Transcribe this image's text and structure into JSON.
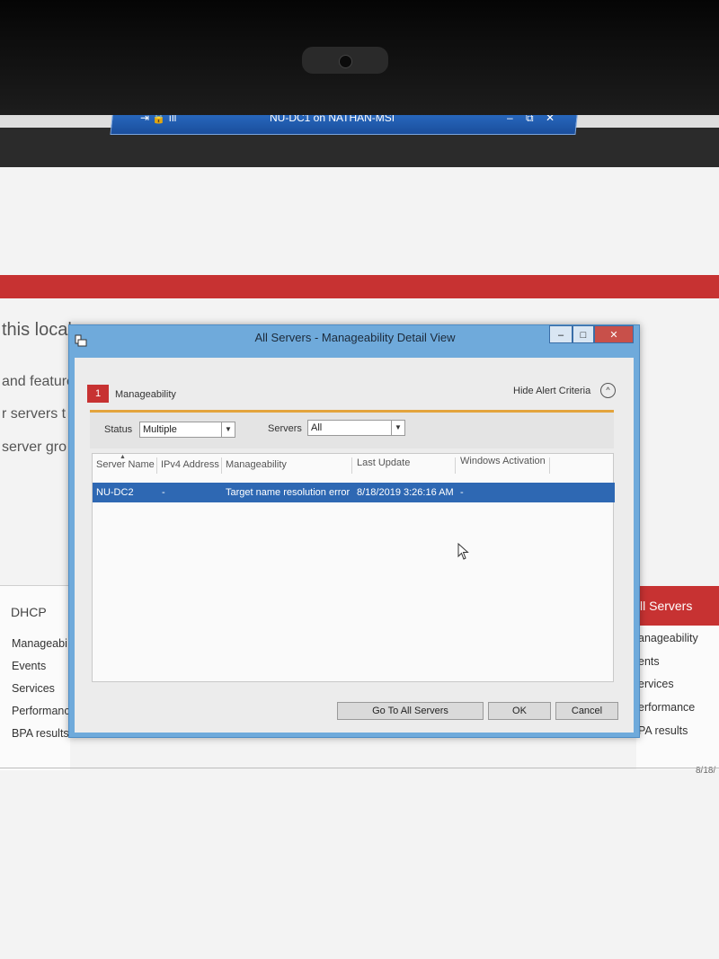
{
  "rdp_bar": {
    "title": "NU-DC1 on NATHAN-MSI",
    "left_icons": "⇥ 🔒 ıll",
    "minimize": "–",
    "restore": "⧉",
    "close": "✕"
  },
  "background": {
    "heading": "this local server",
    "links": [
      "and features",
      "r servers t",
      "server gro"
    ],
    "left_panel": {
      "title": "DHCP",
      "items": [
        "Manageabi",
        "Events",
        "Services",
        "Performanc",
        "BPA results"
      ]
    },
    "right_panel": {
      "title": "ll Servers",
      "items": [
        "anageability",
        "ents",
        "ervices",
        "erformance",
        "PA results"
      ]
    },
    "date": "8/18/"
  },
  "dialog": {
    "title": "All Servers - Manageability Detail View",
    "controls": {
      "minimize": "–",
      "maximize": "□",
      "close": "✕"
    },
    "badge_count": "1",
    "badge_label": "Manageability",
    "hide_alert": "Hide Alert Criteria",
    "hide_icon": "^",
    "filters": {
      "status_label": "Status",
      "status_value": "Multiple",
      "servers_label": "Servers",
      "servers_value": "All"
    },
    "columns": [
      "Server Name",
      "IPv4 Address",
      "Manageability",
      "Last Update",
      "Windows Activation"
    ],
    "rows": [
      {
        "server_name": "NU-DC2",
        "ipv4": "-",
        "manageability": "Target name resolution error",
        "last_update": "8/18/2019 3:26:16 AM",
        "activation": "-"
      }
    ],
    "buttons": {
      "go_to": "Go To All Servers",
      "ok": "OK",
      "cancel": "Cancel"
    }
  }
}
